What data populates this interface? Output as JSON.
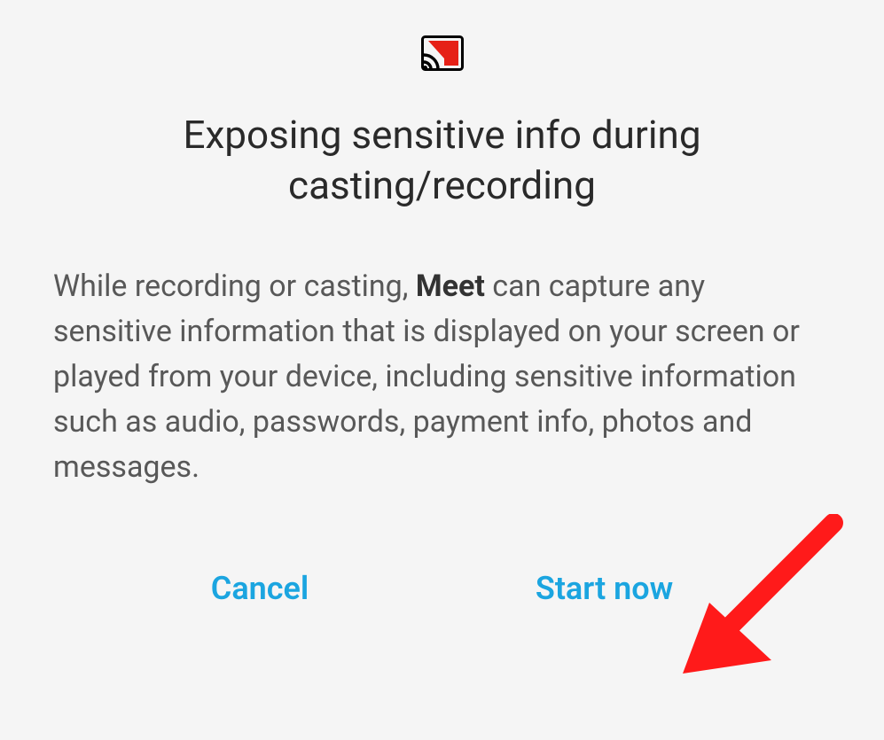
{
  "dialog": {
    "title": "Exposing sensitive info during casting/recording",
    "body_prefix": "While recording or casting, ",
    "app_name": "Meet",
    "body_suffix": " can capture any sensitive information that is displayed on your screen or played from your device, including sensitive information such as audio, passwords, payment info, photos and messages.",
    "cancel_label": "Cancel",
    "start_label": "Start now"
  }
}
